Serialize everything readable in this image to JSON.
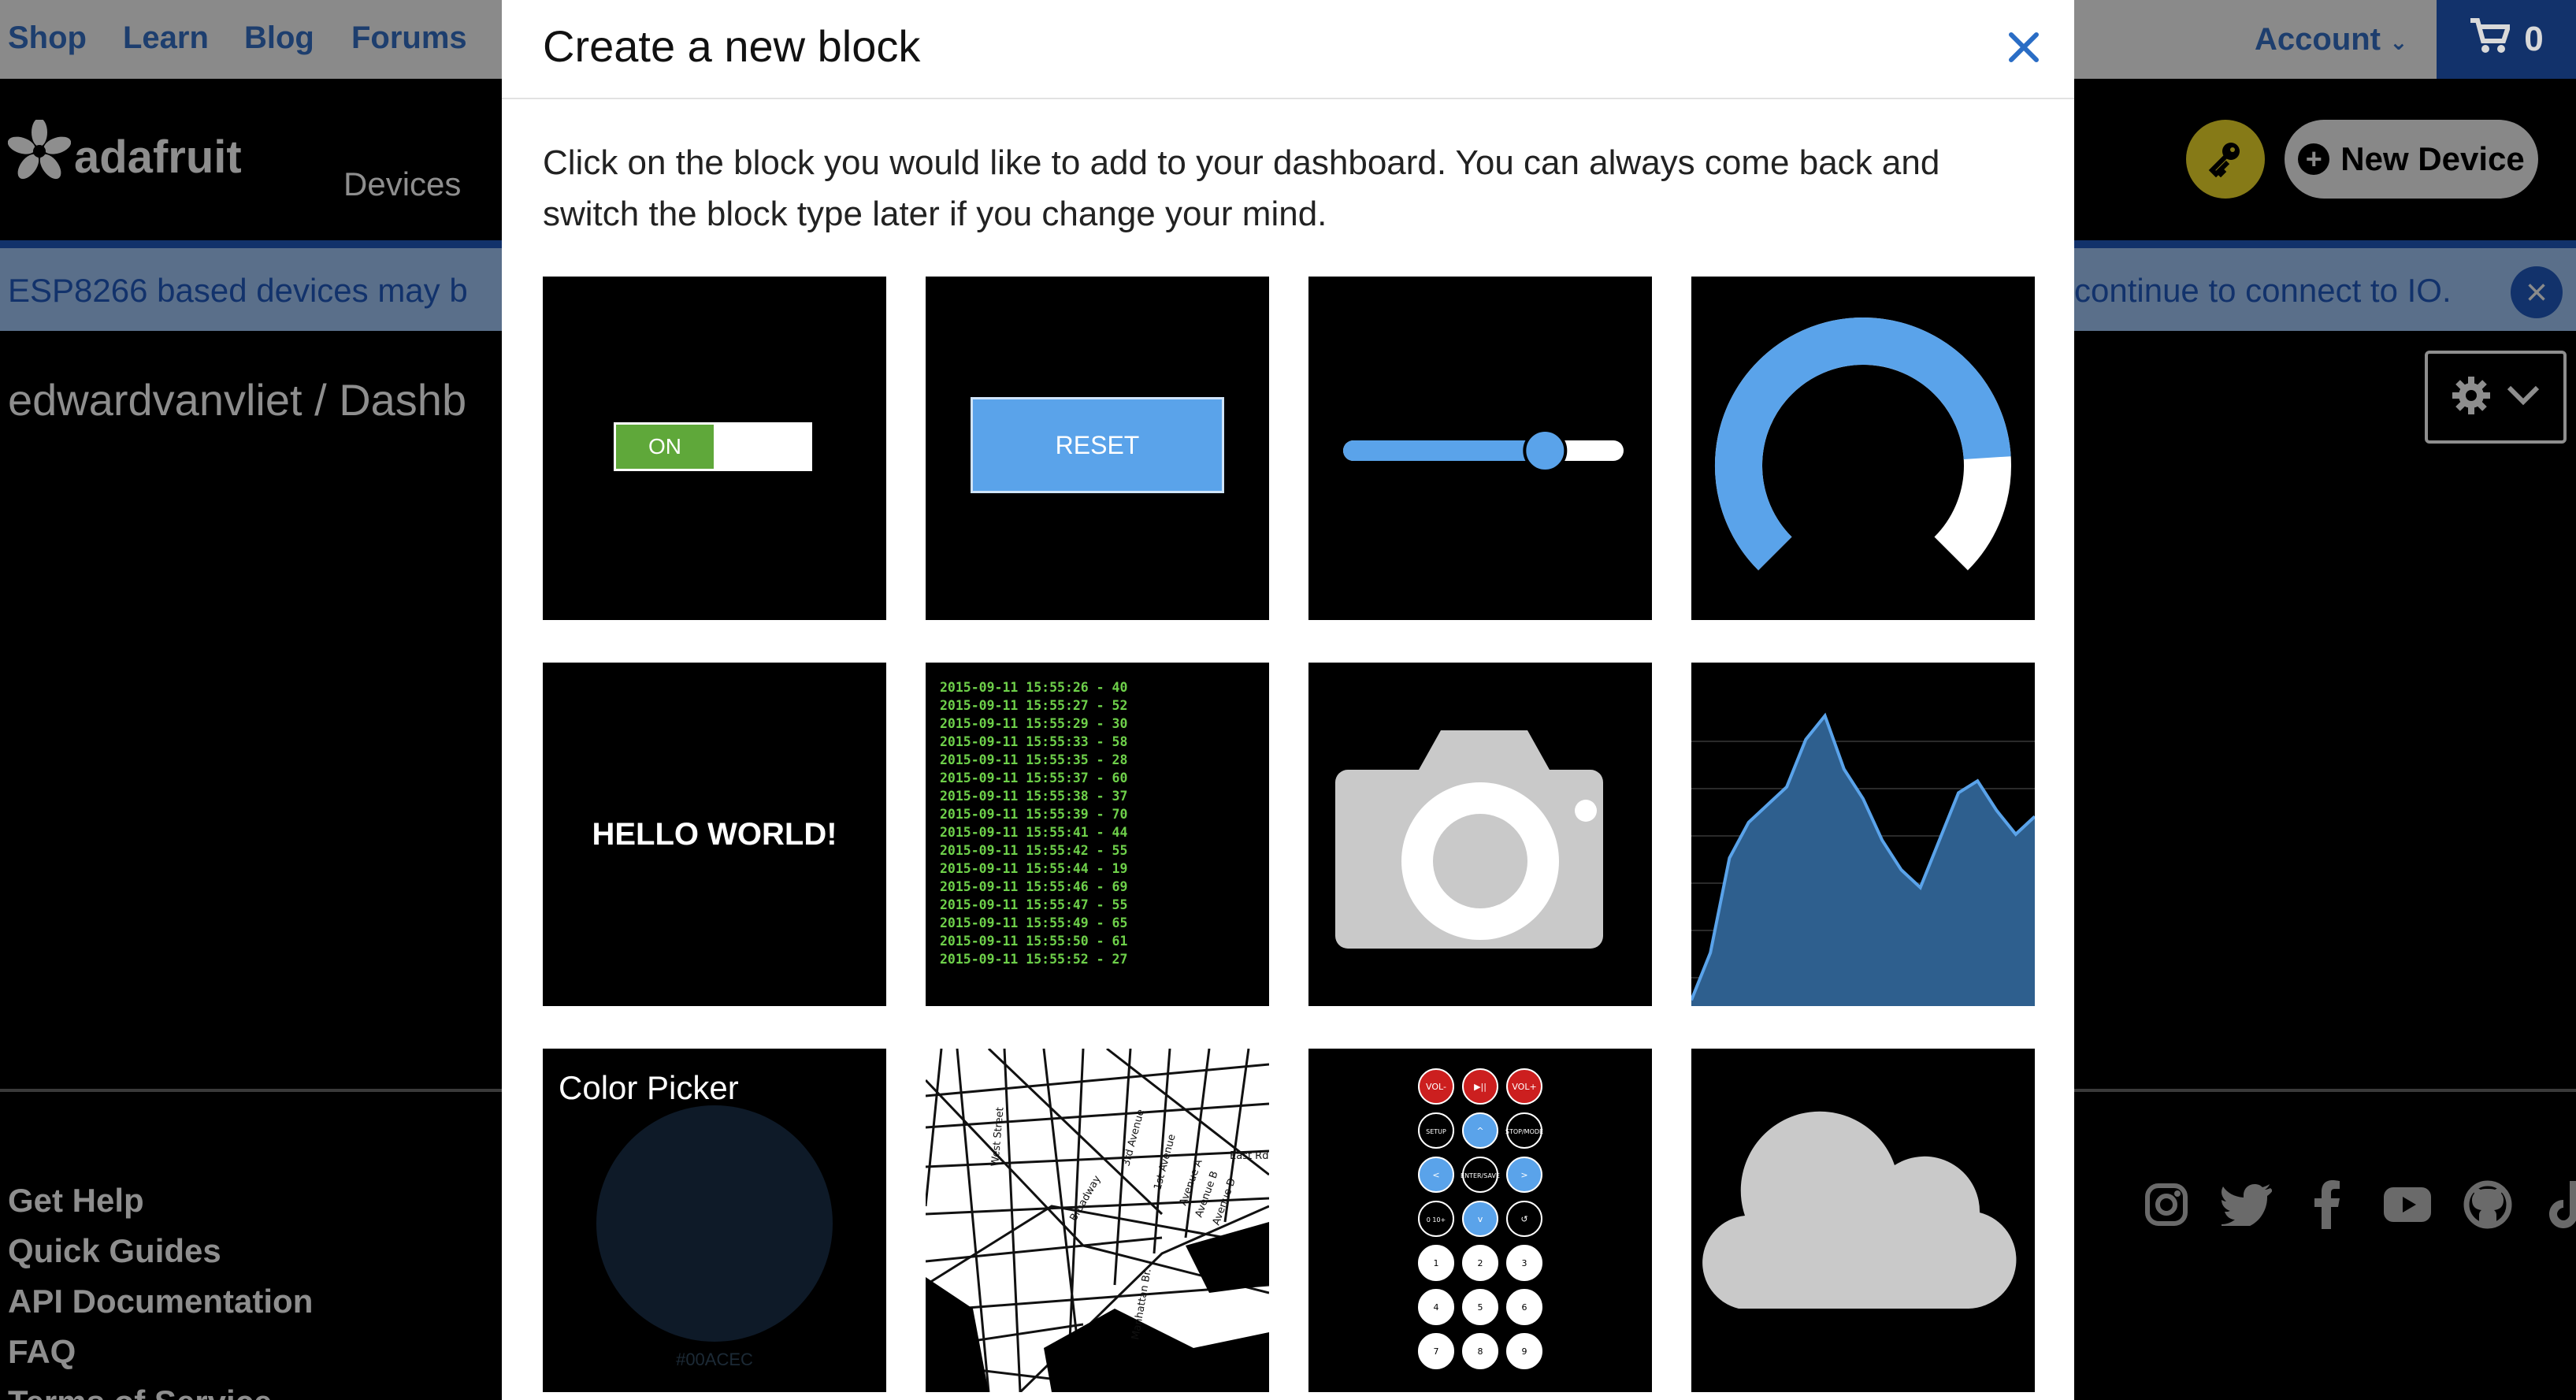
{
  "topbar": {
    "links": [
      "Shop",
      "Learn",
      "Blog",
      "Forums"
    ],
    "account_label": "Account",
    "cart_count": "0"
  },
  "header": {
    "logo_text": "adafruit",
    "nav_devices": "Devices",
    "new_device_label": "New Device"
  },
  "banner": {
    "text_left": "ESP8266 based devices may b",
    "text_right": "continue to connect to IO."
  },
  "breadcrumb": "edwardvanvliet / Dashb",
  "footer": {
    "links": [
      "Get Help",
      "Quick Guides",
      "API Documentation",
      "FAQ",
      "Terms of Service"
    ]
  },
  "modal": {
    "title": "Create a new block",
    "description": "Click on the block you would like to add to your dashboard. You can always come back and switch the block type later if you change your mind.",
    "blocks": {
      "toggle_label": "ON",
      "reset_label": "RESET",
      "slider_level": 0.72,
      "gauge_level": 0.82,
      "text_label": "HELLO WORLD!",
      "stream_lines": [
        "2015-09-11 15:55:26 - 40",
        "2015-09-11 15:55:27 - 52",
        "2015-09-11 15:55:29 - 30",
        "2015-09-11 15:55:33 - 58",
        "2015-09-11 15:55:35 - 28",
        "2015-09-11 15:55:37 - 60",
        "2015-09-11 15:55:38 - 37",
        "2015-09-11 15:55:39 - 70",
        "2015-09-11 15:55:41 - 44",
        "2015-09-11 15:55:42 - 55",
        "2015-09-11 15:55:44 - 19",
        "2015-09-11 15:55:46 - 69",
        "2015-09-11 15:55:47 - 55",
        "2015-09-11 15:55:49 - 65",
        "2015-09-11 15:55:50 - 61",
        "2015-09-11 15:55:52 - 27"
      ],
      "chart_values": [
        2,
        18,
        50,
        62,
        68,
        74,
        90,
        98,
        80,
        70,
        56,
        46,
        40,
        56,
        72,
        76,
        66,
        58,
        64
      ],
      "color_picker_label": "Color Picker",
      "color_picker_hex": "#00ACEC",
      "remote_buttons": [
        "VOL-",
        "▶||",
        "VOL+",
        "SETUP",
        "^",
        "STOP/MODE",
        "<",
        "ENTER/SAVE",
        ">",
        "0 10+",
        "v",
        "↺",
        "1",
        "2",
        "3",
        "4",
        "5",
        "6",
        "7",
        "8",
        "9"
      ],
      "map_labels": [
        "West Street",
        "3rd Avenue",
        "1st Avenue",
        "Avenue A",
        "Avenue B",
        "Avenue D",
        "Broadway",
        "East Rd",
        "Manhattan Br."
      ]
    }
  },
  "colors": {
    "accent_blue": "#5aa3ea",
    "navy": "#12326b",
    "toggle_green": "#5fa83a",
    "chart_fill": "#2e5f8e"
  }
}
